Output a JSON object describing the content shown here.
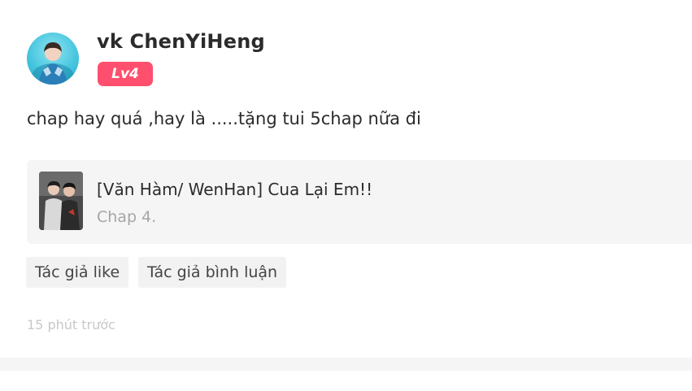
{
  "comment": {
    "user": {
      "name": "vk ChenYiHeng",
      "level": "Lv4"
    },
    "text": "chap hay quá ,hay là .....tặng tui 5chap nữa đi",
    "reference": {
      "title": "[Văn Hàm/ WenHan] Cua Lại Em!!",
      "chapter": "Chap 4."
    },
    "tags": [
      "Tác giả like",
      "Tác giả bình luận"
    ],
    "timestamp": "15 phút trước"
  },
  "colors": {
    "level_badge": "#ff4f6e",
    "reference_bg": "#f5f5f5",
    "tag_bg": "#f2f2f2",
    "muted_text": "#a6a6a6"
  }
}
